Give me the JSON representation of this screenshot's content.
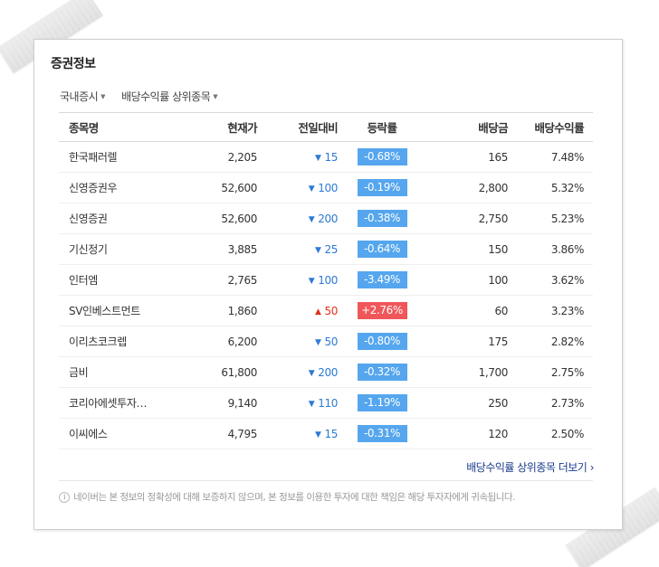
{
  "card": {
    "title": "증권정보",
    "filters": [
      {
        "label": "국내증시"
      },
      {
        "label": "배당수익률 상위종목"
      }
    ],
    "columns": [
      "종목명",
      "현재가",
      "전일대비",
      "등락률",
      "배당금",
      "배당수익률"
    ],
    "rows": [
      {
        "name": "한국패러렐",
        "price": "2,205",
        "direction": "down",
        "change": "15",
        "rate": "-0.68%",
        "dividend": "165",
        "yield": "7.48%"
      },
      {
        "name": "신영증권우",
        "price": "52,600",
        "direction": "down",
        "change": "100",
        "rate": "-0.19%",
        "dividend": "2,800",
        "yield": "5.32%"
      },
      {
        "name": "신영증권",
        "price": "52,600",
        "direction": "down",
        "change": "200",
        "rate": "-0.38%",
        "dividend": "2,750",
        "yield": "5.23%"
      },
      {
        "name": "기신정기",
        "price": "3,885",
        "direction": "down",
        "change": "25",
        "rate": "-0.64%",
        "dividend": "150",
        "yield": "3.86%"
      },
      {
        "name": "인터엠",
        "price": "2,765",
        "direction": "down",
        "change": "100",
        "rate": "-3.49%",
        "dividend": "100",
        "yield": "3.62%"
      },
      {
        "name": "SV인베스트먼트",
        "price": "1,860",
        "direction": "up",
        "change": "50",
        "rate": "+2.76%",
        "dividend": "60",
        "yield": "3.23%"
      },
      {
        "name": "이리츠코크렙",
        "price": "6,200",
        "direction": "down",
        "change": "50",
        "rate": "-0.80%",
        "dividend": "175",
        "yield": "2.82%"
      },
      {
        "name": "금비",
        "price": "61,800",
        "direction": "down",
        "change": "200",
        "rate": "-0.32%",
        "dividend": "1,700",
        "yield": "2.75%"
      },
      {
        "name": "코리아에셋투자…",
        "price": "9,140",
        "direction": "down",
        "change": "110",
        "rate": "-1.19%",
        "dividend": "250",
        "yield": "2.73%"
      },
      {
        "name": "이씨에스",
        "price": "4,795",
        "direction": "down",
        "change": "15",
        "rate": "-0.31%",
        "dividend": "120",
        "yield": "2.50%"
      }
    ],
    "more_link": "배당수익률 상위종목 더보기",
    "disclaimer": "네이버는 본 정보의 정확성에 대해 보증하지 않으며, 본 정보를 이용한 투자에 대한 책임은 해당 투자자에게 귀속됩니다."
  },
  "icons": {
    "filter_caret": "caret-down-icon",
    "down_arrow": "triangle-down-icon",
    "up_arrow": "triangle-up-icon",
    "more_chevron": "chevron-right-icon",
    "info": "info-icon"
  },
  "colors": {
    "down_text": "#2c7ad6",
    "up_text": "#e0301e",
    "down_badge": "#55a6ee",
    "up_badge": "#f0575a",
    "link": "#1a3c8c"
  }
}
